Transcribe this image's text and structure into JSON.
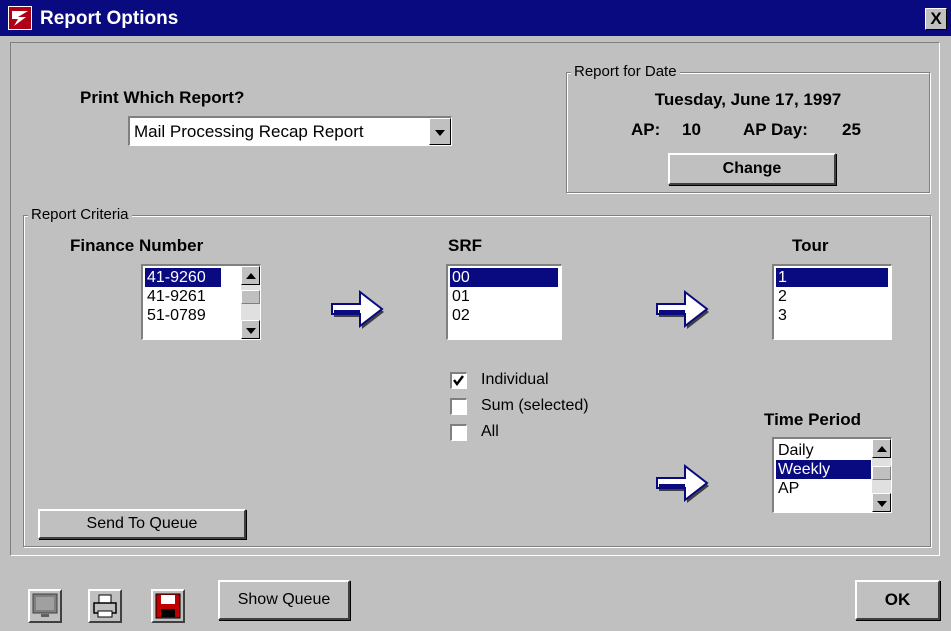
{
  "window": {
    "title": "Report Options",
    "close_label": "X"
  },
  "report_select": {
    "label": "Print Which Report?",
    "value": "Mail Processing Recap Report"
  },
  "report_date": {
    "group_label": "Report for Date",
    "date": "Tuesday, June 17, 1997",
    "ap_label": "AP:",
    "ap_value": "10",
    "ap_day_label": "AP Day:",
    "ap_day_value": "25",
    "change_button": "Change"
  },
  "criteria": {
    "group_label": "Report Criteria",
    "finance": {
      "label": "Finance Number",
      "items": [
        "41-9260",
        "41-9261",
        "51-0789"
      ],
      "selected": "41-9260"
    },
    "srf": {
      "label": "SRF",
      "items": [
        "00",
        "01",
        "02"
      ],
      "selected": "00"
    },
    "tour": {
      "label": "Tour",
      "items": [
        "1",
        "2",
        "3"
      ],
      "selected": "1"
    },
    "options": [
      {
        "label": "Individual",
        "checked": true
      },
      {
        "label": "Sum (selected)",
        "checked": false
      },
      {
        "label": "All",
        "checked": false
      }
    ],
    "time_period": {
      "label": "Time Period",
      "items": [
        "Daily",
        "Weekly",
        "AP"
      ],
      "selected": "Weekly"
    },
    "send_button": "Send To Queue"
  },
  "toolbar": {
    "icons": [
      "monitor-icon",
      "printer-icon",
      "save-disk-icon"
    ],
    "show_queue": "Show Queue",
    "ok": "OK"
  },
  "colors": {
    "titlebar": "#0a0a80",
    "selection": "#0a0a80",
    "face": "#c0c0c0",
    "arrow": "#0a0a80",
    "disk": "#c00000"
  }
}
